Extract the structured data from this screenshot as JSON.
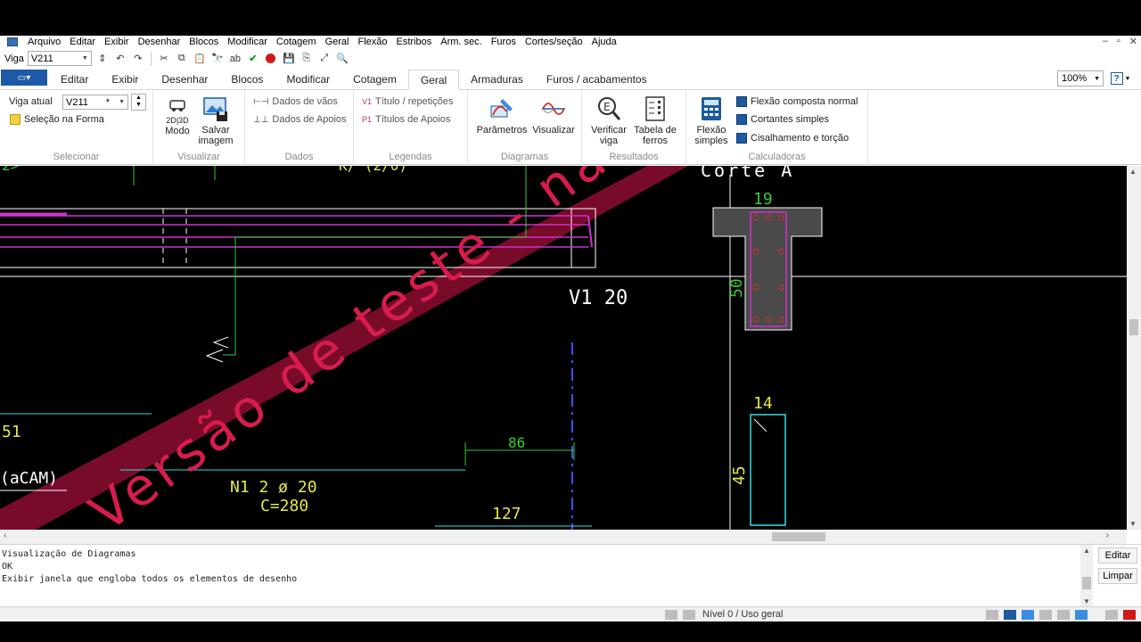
{
  "menubar": {
    "items": [
      "Arquivo",
      "Editar",
      "Exibir",
      "Desenhar",
      "Blocos",
      "Modificar",
      "Cotagem",
      "Geral",
      "Flexão",
      "Estribos",
      "Arm. sec.",
      "Furos",
      "Cortes/seção",
      "Ajuda"
    ]
  },
  "quickbar": {
    "label": "Viga",
    "beam_value": "V211"
  },
  "tabs": {
    "items": [
      "Editar",
      "Exibir",
      "Desenhar",
      "Blocos",
      "Modificar",
      "Cotagem",
      "Geral",
      "Armaduras",
      "Furos / acabamentos"
    ],
    "active": "Geral",
    "zoom": "100%"
  },
  "ribbon": {
    "selecionar": {
      "label": "Selecionar",
      "viga_atual_label": "Viga atual",
      "viga_atual_value": "V211",
      "viga_atual_mark": "*",
      "selecao_forma": "Seleção na Forma"
    },
    "visualizar": {
      "label": "Visualizar",
      "modo_icon_text": "2D|3D",
      "modo": "Modo",
      "salvar": "Salvar imagem"
    },
    "dados": {
      "label": "Dados",
      "vaos": "Dados de vãos",
      "apoios": "Dados de Apoios"
    },
    "legendas": {
      "label": "Legendas",
      "titulo": "Título / repetições",
      "titulos_apoios": "Títulos de Apoios"
    },
    "diagramas": {
      "label": "Diagramas",
      "parametros": "Parâmetros",
      "visualizar": "Visualizar"
    },
    "resultados": {
      "label": "Resultados",
      "verificar": "Verificar viga",
      "tabela": "Tabela de ferros"
    },
    "calculadoras": {
      "label": "Calculadoras",
      "flexao_simples": "Flexão simples",
      "flexao_composta": "Flexão composta normal",
      "cortantes": "Cortantes simples",
      "cisalhamento": "Cisalhamento e torção"
    }
  },
  "drawing": {
    "watermark": "Versão de teste - não use nesto viga",
    "top_left_partial": "2>",
    "top_partial": "K/ (2/0)",
    "beam_label": "V1 20",
    "corte_label": "Corte A",
    "section1_width": "19",
    "section1_height": "50",
    "section2_width": "14",
    "section2_height": "45",
    "dim_86": "86",
    "dim_127": "127",
    "left_51": "51",
    "left_cam": "(aCAM)",
    "bar_label": "N1  2 ø 20",
    "bar_length": "C=280",
    "colors": {
      "background": "#000000",
      "white_line": "#ffffff",
      "magenta": "#cc33cc",
      "green": "#33cc33",
      "cyan": "#33dddd",
      "yellow": "#e6e64d",
      "watermark": "#b3103c",
      "blue_axis": "#3355ff"
    }
  },
  "log": {
    "lines": [
      "Visualização de Diagramas",
      "OK",
      "Exibir janela que engloba todos os elementos de desenho"
    ],
    "edit": "Editar",
    "clear": "Limpar"
  },
  "status": {
    "text": "Nível 0 / Uso geral"
  }
}
